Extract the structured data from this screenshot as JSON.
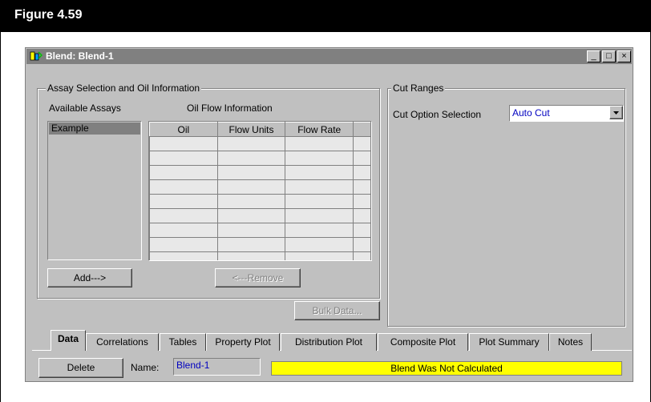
{
  "figure": {
    "title": "Figure 4.59"
  },
  "window": {
    "title": "Blend: Blend-1",
    "controls": {
      "minimize": "_",
      "maximize": "□",
      "close": "×"
    }
  },
  "assay_group": {
    "legend": "Assay Selection and Oil Information",
    "available_label": "Available Assays",
    "available_items": [
      "Example"
    ],
    "oil_flow_label": "Oil Flow Information",
    "columns": [
      "Oil",
      "Flow Units",
      "Flow Rate"
    ],
    "add_button": "Add--->",
    "remove_button": "<---Remove",
    "bulk_button": "Bulk Data..."
  },
  "cut_group": {
    "legend": "Cut Ranges",
    "option_label": "Cut Option Selection",
    "option_value": "Auto Cut"
  },
  "tabs": [
    "Data",
    "Correlations",
    "Tables",
    "Property Plot",
    "Distribution Plot",
    "Composite Plot",
    "Plot Summary",
    "Notes"
  ],
  "footer": {
    "delete_button": "Delete",
    "name_label": "Name:",
    "name_value": "Blend-1",
    "status": "Blend Was Not Calculated",
    "status_color": "#ffff00"
  },
  "colors": {
    "accent_text": "#0000c0",
    "selection": "#808080"
  }
}
